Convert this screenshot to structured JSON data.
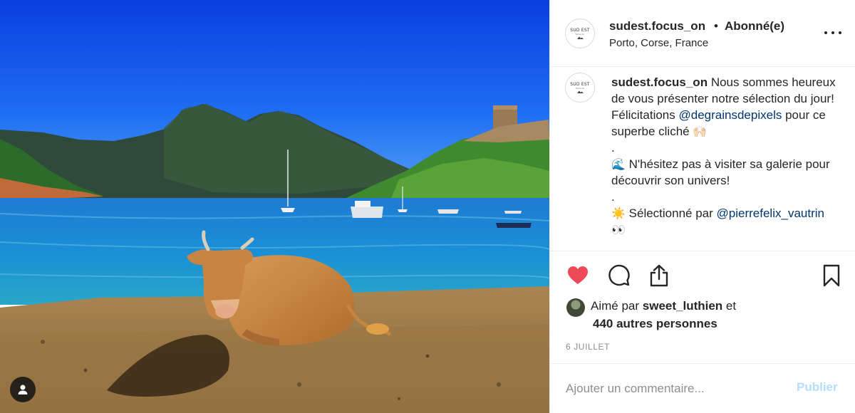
{
  "photo": {
    "description_icon": "user-tag-icon"
  },
  "header": {
    "avatar_text_line1": "SUD EST",
    "avatar_text_line2": "focus on",
    "username": "sudest.focus_on",
    "separator": "•",
    "follow_status": "Abonné(e)",
    "location": "Porto, Corse, France",
    "more_icon": "more-options-icon"
  },
  "caption": {
    "username": "sudest.focus_on",
    "text_1": "Nous sommes heureux de vous présenter notre sélection du jour! Félicitations",
    "mention_1": "@degrainsdepixels",
    "text_2": "pour ce superbe cliché",
    "emoji_1": "🙌🏻",
    "dot_1": ".",
    "emoji_2": "🌊",
    "text_3": "N'hésitez pas à visiter sa galerie pour découvrir son univers!",
    "dot_2": ".",
    "emoji_3": "☀️",
    "text_4": "Sélectionné par",
    "mention_2": "@pierrefelix_vautrin",
    "emoji_4": "👀"
  },
  "actions": {
    "like_icon": "heart-filled-icon",
    "comment_icon": "comment-icon",
    "share_icon": "share-icon",
    "save_icon": "bookmark-icon",
    "like_color": "#ed4956"
  },
  "likes": {
    "prefix": "Aimé par",
    "liker": "sweet_luthien",
    "conjunction": "et",
    "others": "440 autres personnes"
  },
  "date": "6 JUILLET",
  "comment": {
    "placeholder": "Ajouter un commentaire...",
    "post_label": "Publier",
    "post_color": "#b2dffc"
  }
}
